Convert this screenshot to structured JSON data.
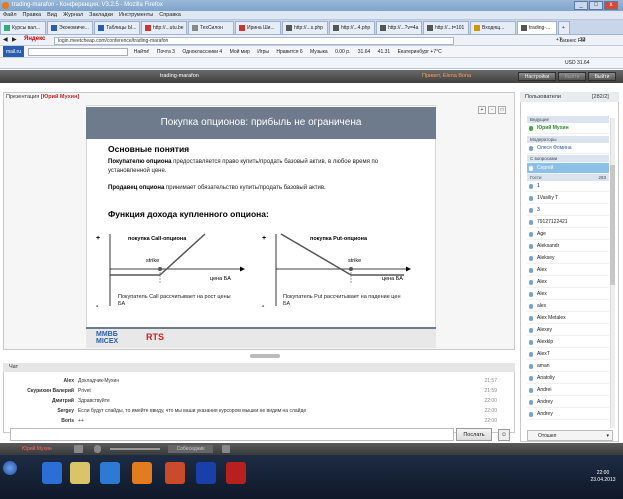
{
  "window": {
    "title": "trading-marafon - Конференция, V3.2.5 - Mozilla Firefox",
    "controls": [
      "_",
      "□",
      "x"
    ]
  },
  "menu": [
    "Файл",
    "Правка",
    "Вид",
    "Журнал",
    "Закладки",
    "Инструменты",
    "Справка"
  ],
  "tabs": [
    "Курсы вал...",
    "Экономиче...",
    "Таблицы Ы...",
    "http://...utu.be",
    "ТехСилон",
    "Ирина Ши...",
    "http://...s.php",
    "http://...4.php",
    "http://...?v=4a",
    "http://...t=101",
    "Входящ...",
    "trading-...",
    "+"
  ],
  "address": {
    "url": "login.meetcheap.com/conference/trading-marafon",
    "brand": "Яндекс",
    "counter": "+7",
    "karma": "23"
  },
  "toolbar1": {
    "site": "mail.ru",
    "search_label": "Найти!",
    "items": [
      "Почта 3",
      "Одноклассники 4",
      "Мой мир",
      "Игры",
      "Нравится 6",
      "Музыка",
      "0.00 р.",
      "31.64",
      "41.31",
      "Екатеринбург +7°C"
    ],
    "business": "Бизнес FM",
    "usd": "USD 31.64"
  },
  "app": {
    "title": "trading-marafon",
    "greeting": "Привет, Elena Bona",
    "buttons": [
      "Настройки",
      "Выйти",
      "Выйти"
    ]
  },
  "presentation": {
    "label": "Презентация",
    "presenter": "[Юрий Мухин]",
    "slide_title": "Покупка опционов:   прибыль не ограничена",
    "section1": "Основные понятия",
    "buyer_term": "Покупателю опциона",
    "buyer_text": "предоставляется право купить/продать базовый актив, в любое время по установленной цене.",
    "seller_term": "Продавец опциона",
    "seller_text": "принимает обязательство купить/продать базовый актив.",
    "section2": "Функция дохода купленного опциона:",
    "chart_left": {
      "title": "покупка Call-опциона",
      "strike": "strike",
      "axis": "цена БА",
      "caption": "Покупатель Call рассчитывает на рост цены БА",
      "plus": "+",
      "minus": "-"
    },
    "chart_right": {
      "title": "покупка Put-опциона",
      "strike": "strike",
      "axis": "цена БА",
      "caption": "Покупатель Put рассчитывает на падение цен БА",
      "plus": "+",
      "minus": "-"
    },
    "logo1": "ММВБ МІСЕХ",
    "logo2": "RTS"
  },
  "chat": {
    "label": "Чат",
    "messages": [
      {
        "name": "Alex",
        "text": "Докладчик-Мухин",
        "time": "21:57"
      },
      {
        "name": "Скурихин Валерий",
        "text": "Privet",
        "time": "21:59"
      },
      {
        "name": "Дмитрий",
        "text": "Здравствуйте",
        "time": "22:00"
      },
      {
        "name": "Sergey",
        "text": "Если будут слайды, то имейте ввиду, что мы ваши указания курсором мышки не видим на слайде",
        "time": "22:00"
      },
      {
        "name": "Boris",
        "text": "++",
        "time": "22:00"
      }
    ],
    "send": "Послать"
  },
  "status": {
    "user": "Юрий Мухин",
    "mode": "Собеседник"
  },
  "users": {
    "label": "Пользователи",
    "count": "[282/2]",
    "groups": [
      {
        "title": "Ведущие",
        "items": [
          "Юрий Мухин"
        ]
      },
      {
        "title": "Модераторы",
        "items": [
          "Олеся Фомина"
        ]
      },
      {
        "title": "С вопросами",
        "items": [
          "Сергей"
        ]
      },
      {
        "title": "Гости",
        "count": "283",
        "items": [
          "1",
          "1Vasiliy T",
          "3",
          "79127122421",
          "Age",
          "Aleksandr",
          "Aleksey",
          "Alex",
          "Alex",
          "Alex",
          "alex",
          "Alex Metalex",
          "Alexey",
          "Alexklp",
          "AlexT",
          "aman",
          "Anatoliy",
          "Andrei",
          "Andrey",
          "Andrey"
        ]
      }
    ],
    "footer": "Отошел"
  },
  "taskbar": {
    "time": "22:00",
    "date": "23.04.2013"
  }
}
